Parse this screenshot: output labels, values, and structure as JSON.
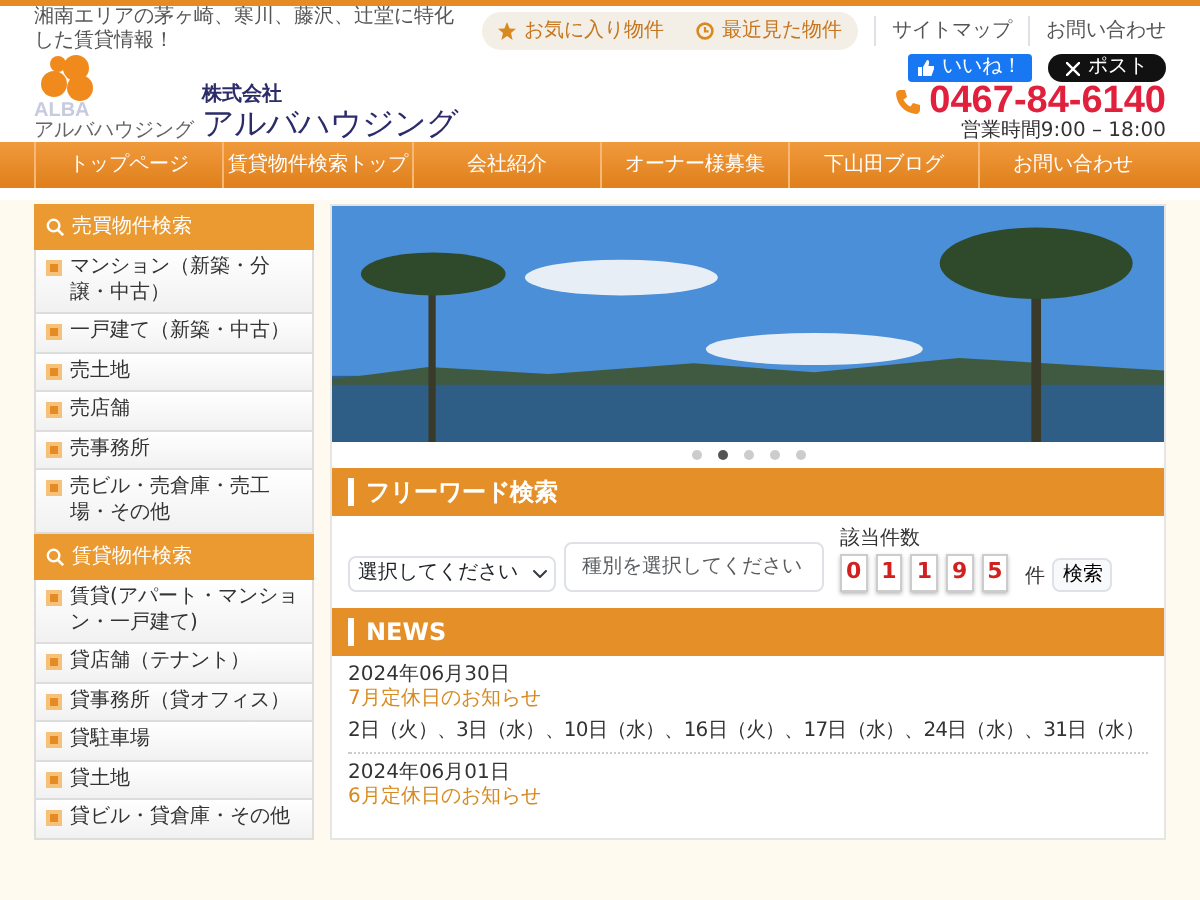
{
  "header": {
    "tagline": "湘南エリアの茅ヶ崎、寒川、藤沢、辻堂に特化した賃貸情報！",
    "top_links": [
      {
        "label": "お気に入り物件",
        "kind": "star"
      },
      {
        "label": "最近見た物件",
        "kind": "history"
      }
    ],
    "utility_links": [
      "サイトマップ",
      "お問い合わせ"
    ],
    "logo": {
      "company_type": "株式会社",
      "name": "アルバハウジング",
      "mark_text": "ALBA",
      "mark_subtext": "アルバハウジング"
    },
    "social": [
      {
        "label": "いいね！",
        "kind": "like"
      },
      {
        "label": "ポスト",
        "kind": "x"
      }
    ],
    "phone": "0467-84-6140",
    "hours": "営業時間9:00 – 18:00"
  },
  "nav": [
    "トップページ",
    "賃貸物件検索トップ",
    "会社紹介",
    "オーナー様募集",
    "下山田ブログ",
    "お問い合わせ"
  ],
  "sidebar": [
    {
      "title": "売買物件検索",
      "items": [
        "マンション（新築・分譲・中古）",
        "一戸建て（新築・中古）",
        "売土地",
        "売店舗",
        "売事務所",
        "売ビル・売倉庫・売工場・その他"
      ]
    },
    {
      "title": "賃貸物件検索",
      "items": [
        "賃貸(アパート・マンション・一戸建て)",
        "貸店舗（テナント）",
        "貸事務所（貸オフィス）",
        "貸駐車場",
        "貸土地",
        "貸ビル・貸倉庫・その他"
      ]
    }
  ],
  "slider": {
    "dots": [
      {
        "selected": false
      },
      {
        "selected": true
      },
      {
        "selected": false
      },
      {
        "selected": false
      },
      {
        "selected": false
      }
    ]
  },
  "free_search": {
    "title": "フリーワード検索",
    "select_value": "選択してください",
    "placeholder": "種別を選択してください",
    "count_label": "該当件数",
    "count_digits": [
      "0",
      "1",
      "1",
      "9",
      "5"
    ],
    "unit": "件",
    "button": "検索"
  },
  "news": {
    "title": "NEWS",
    "items": [
      {
        "date": "2024年06月30日",
        "title": "7月定休日のお知らせ",
        "body": "2日（火）、3日（水）、10日（水）、16日（火）、17日（水）、24日（水）、31日（水）"
      },
      {
        "date": "2024年06月01日",
        "title": "6月定休日のお知らせ"
      }
    ]
  }
}
